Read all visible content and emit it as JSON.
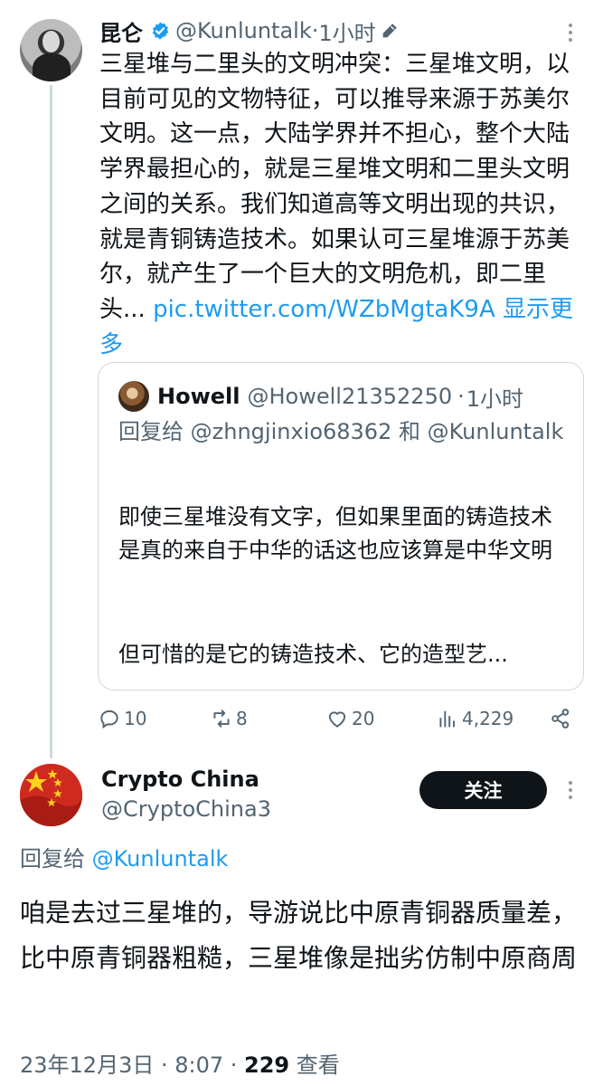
{
  "tweet1": {
    "author_name": "昆仑",
    "handle": "@Kunluntalk",
    "separator": "·",
    "time": "1小时",
    "body": "三星堆与二里头的文明冲突：三星堆文明，以目前可见的文物特征，可以推导来源于苏美尔文明。这一点，大陆学界并不担心，整个大陆学界最担心的，就是三星堆文明和二里头文明之间的关系。我们知道高等文明出现的共识，就是青铜铸造技术。如果认可三星堆源于苏美尔，就产生了一个巨大的文明危机，即二里头... ",
    "link": "pic.twitter.com/WZbMgtaK9A",
    "show_more": "显示更多",
    "quote": {
      "author_name": "Howell",
      "handle": "@Howell21352250",
      "separator": "·",
      "time": "1小时",
      "reply_prefix": "回复给",
      "reply_user1": "@zhngjinxio68362",
      "reply_and": "和",
      "reply_user2": "@Kunluntalk",
      "text1": "即使三星堆没有文字，但如果里面的铸造技术是真的来自于中华的话这也应该算是中华文明",
      "text2": "但可惜的是它的铸造技术、它的造型艺..."
    },
    "actions": {
      "replies": "10",
      "retweets": "8",
      "likes": "20",
      "views": "4,229"
    }
  },
  "tweet2": {
    "author_name": "Crypto China",
    "handle": "@CryptoChina3",
    "follow_label": "关注",
    "reply_prefix": "回复给",
    "reply_user": "@Kunluntalk",
    "body": "咱是去过三星堆的，导游说比中原青铜器质量差，比中原青铜器粗糙，三星堆像是拙劣仿制中原商周",
    "date": "23年12月3日 · 8:07 · ",
    "views": "229",
    "views_label": "查看"
  },
  "colors": {
    "link": "#1d9bf0",
    "muted": "#536471",
    "text": "#0f1419",
    "border": "#cfd9de",
    "follow_bg": "#0f1419"
  }
}
